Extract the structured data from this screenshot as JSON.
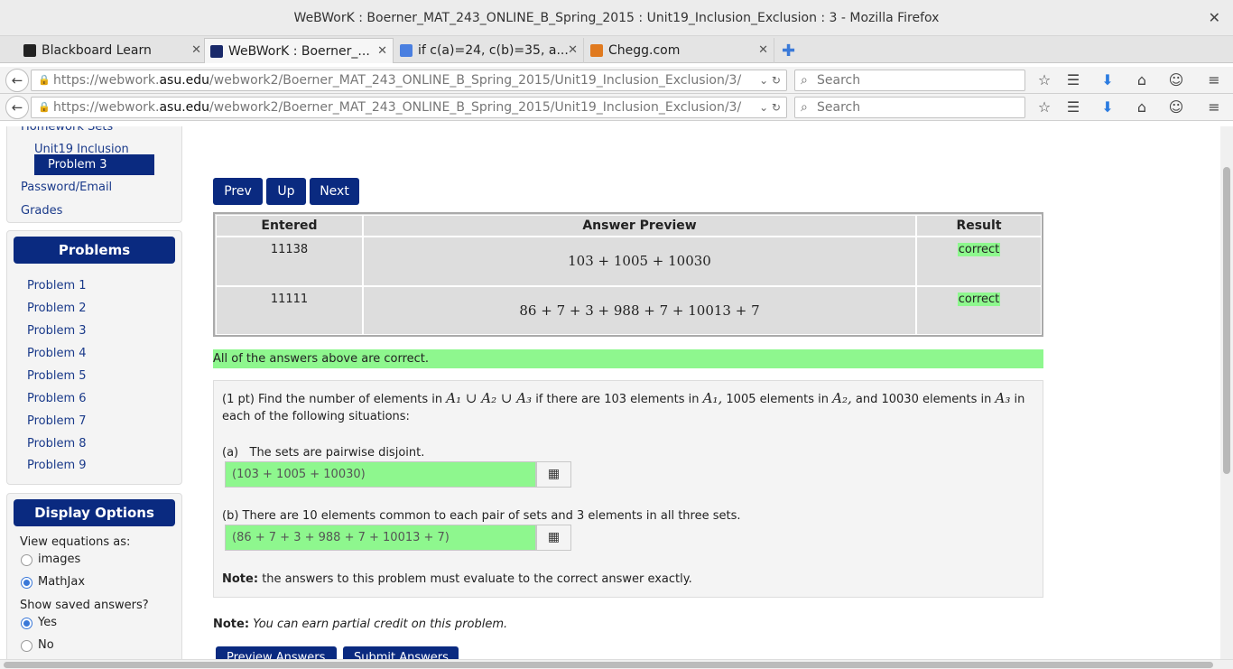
{
  "window": {
    "title": "WeBWorK : Boerner_MAT_243_ONLINE_B_Spring_2015 : Unit19_Inclusion_Exclusion : 3 - Mozilla Firefox",
    "close": "✕"
  },
  "tabs": [
    {
      "label": "Blackboard Learn",
      "icon": "blackboard-icon",
      "color": "#222222"
    },
    {
      "label": "WeBWorK : Boerner_...",
      "icon": "webwork-icon",
      "color": "#1a2a6a"
    },
    {
      "label": "if c(a)=24, c(b)=35, a...",
      "icon": "google-icon",
      "color": "#4a7fe0"
    },
    {
      "label": "Chegg.com",
      "icon": "chegg-icon",
      "color": "#e07a1f"
    }
  ],
  "newtab": "✚",
  "nav": {
    "url_prefix": "https://webwork.",
    "url_host": "asu.edu",
    "url_rest": "/webwork2/Boerner_MAT_243_ONLINE_B_Spring_2015/Unit19_Inclusion_Exclusion/3/",
    "search_placeholder": "Search"
  },
  "sidebar": {
    "homework_sets": "Homework Sets",
    "unit": "Unit19 Inclusion",
    "selected_problem": "Problem 3",
    "password": "Password/Email",
    "grades": "Grades",
    "problems_header": "Problems",
    "problems": [
      "Problem 1",
      "Problem 2",
      "Problem 3",
      "Problem 4",
      "Problem 5",
      "Problem 6",
      "Problem 7",
      "Problem 8",
      "Problem 9"
    ],
    "display_header": "Display Options",
    "view_eq_label": "View equations as:",
    "eq_options": [
      {
        "label": "images",
        "checked": false
      },
      {
        "label": "MathJax",
        "checked": true
      }
    ],
    "saved_label": "Show saved answers?",
    "saved_options": [
      {
        "label": "Yes",
        "checked": true
      },
      {
        "label": "No",
        "checked": false
      }
    ]
  },
  "buttons": {
    "prev": "Prev",
    "up": "Up",
    "next": "Next"
  },
  "results": {
    "headers": {
      "entered": "Entered",
      "preview": "Answer Preview",
      "result": "Result"
    },
    "rows": [
      {
        "entered": "11138",
        "preview": "103 + 1005 + 10030",
        "result": "correct"
      },
      {
        "entered": "11111",
        "preview": "86 + 7 + 3 + 988 + 7 + 10013 + 7",
        "result": "correct"
      }
    ],
    "summary": "All of the answers above are correct."
  },
  "problem": {
    "intro_1": "(1 pt) Find the number of elements in",
    "union": "A₁ ∪ A₂ ∪ A₃",
    "intro_2": "if there are 103 elements in",
    "a1": "A₁,",
    "intro_3": "1005 elements in",
    "a2": "A₂,",
    "intro_4": "and 10030 elements in",
    "a3": "A₃",
    "intro_5": "in",
    "intro_line2": "each of the following situations:",
    "part_a": "(a)   The sets are pairwise disjoint.",
    "answer_a": "(103 + 1005 + 10030)",
    "part_b": "(b)  There are 10 elements common to each pair of sets and 3 elements in all three sets.",
    "answer_b": "(86 + 7 + 3 + 988 + 7 + 10013 + 7)",
    "note_bold": "Note:",
    "note_text": "the answers to this problem must evaluate to the correct answer exactly."
  },
  "bottom": {
    "note_bold": "Note:",
    "note_text": "You can earn partial credit on this problem.",
    "preview_btn": "Preview Answers",
    "submit_btn": "Submit Answers"
  }
}
